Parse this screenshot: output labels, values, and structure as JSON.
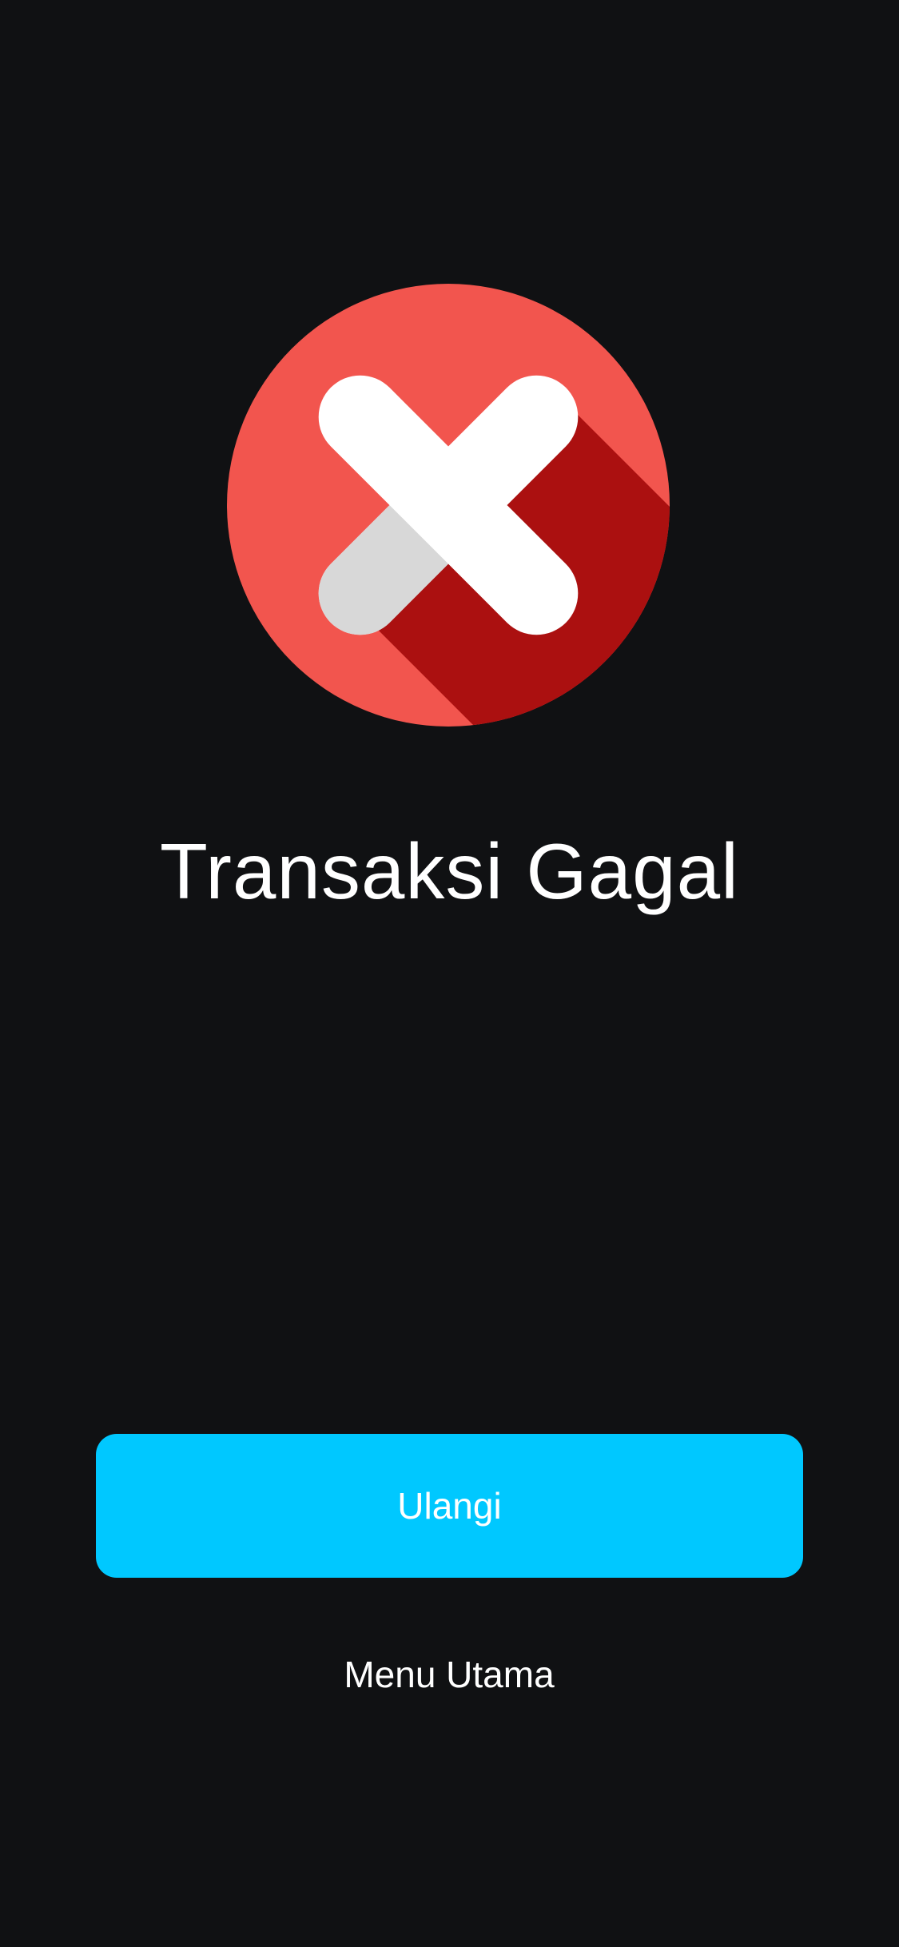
{
  "result": {
    "icon": "error-x-circle-icon",
    "title": "Transaksi Gagal"
  },
  "actions": {
    "retry_label": "Ulangi",
    "home_label": "Menu Utama"
  },
  "colors": {
    "background": "#101113",
    "icon_circle": "#f2554e",
    "icon_shadow": "#ab1010",
    "icon_cross": "#ffffff",
    "icon_cross_shade": "#d8d8d8",
    "primary_button": "#00c8ff",
    "text": "#ffffff"
  }
}
